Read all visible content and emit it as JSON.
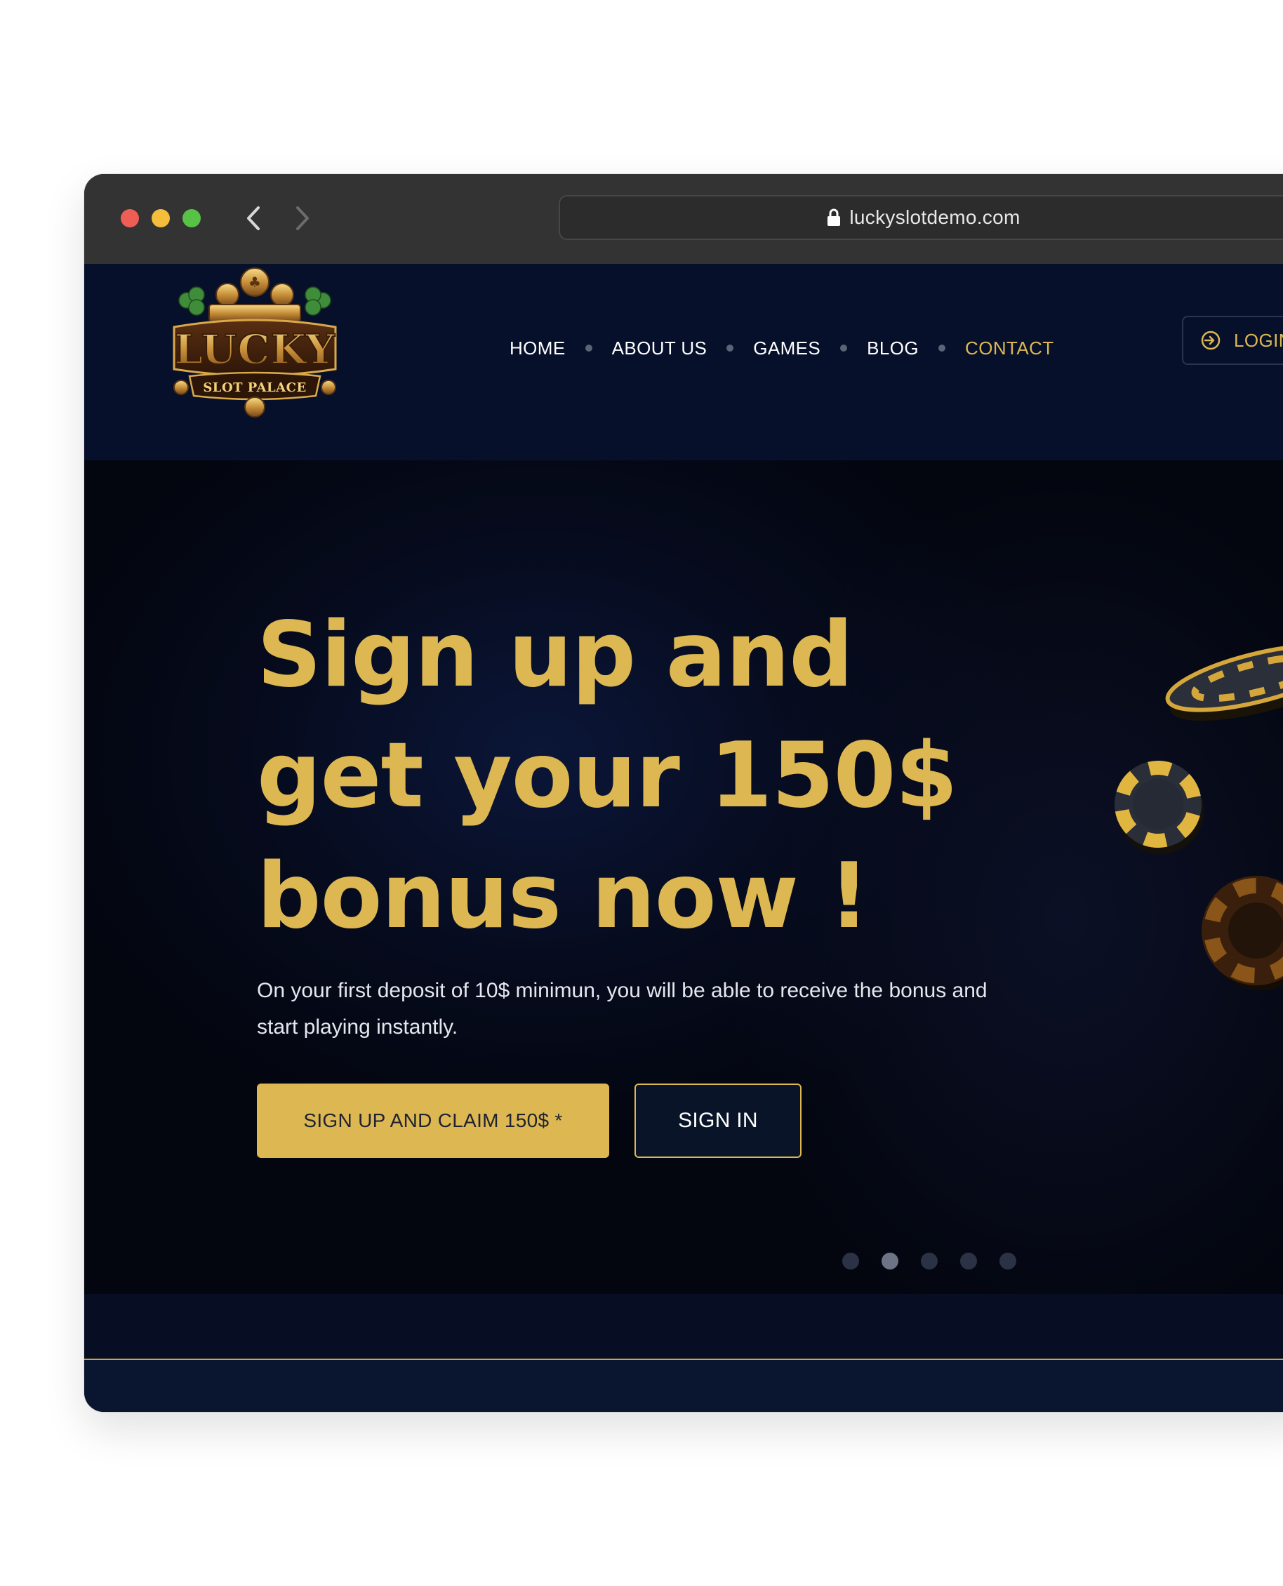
{
  "browser": {
    "url": "luckyslotdemo.com",
    "icons": [
      "back-arrow-icon",
      "forward-arrow-icon",
      "lock-icon",
      "reload-icon"
    ]
  },
  "header": {
    "logo": {
      "top_text": "LUCKY",
      "sub_text": "SLOT PALACE"
    },
    "nav": [
      {
        "label": "HOME",
        "active": false
      },
      {
        "label": "ABOUT US",
        "active": false
      },
      {
        "label": "GAMES",
        "active": false
      },
      {
        "label": "BLOG",
        "active": false
      },
      {
        "label": "CONTACT",
        "active": true
      }
    ],
    "login": {
      "label": "LOGIN",
      "icon": "login-icon"
    }
  },
  "hero": {
    "headline": "Sign up and get your 150$ bonus now !",
    "subtext": "On your first deposit of 10$ minimun, you will be able to receive the bonus and start playing instantly.",
    "primary_button": "SIGN UP AND CLAIM 150$ *",
    "secondary_button": "SIGN IN",
    "carousel": {
      "slides": 5,
      "active_index": 1
    }
  },
  "colors": {
    "accent": "#dcb752",
    "background": "#070d22",
    "hero_background": "#03060f",
    "text": "#ffffff"
  }
}
